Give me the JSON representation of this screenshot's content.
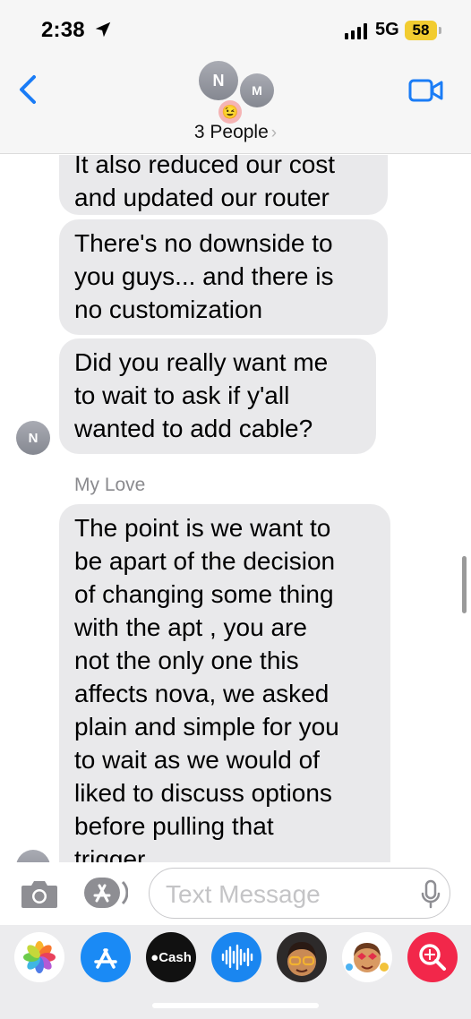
{
  "status_bar": {
    "time": "2:38",
    "network": "5G",
    "battery": "58",
    "battery_color": "#f2cc30"
  },
  "header": {
    "avatars": [
      "N",
      "M"
    ],
    "emoji_avatar": "😉",
    "title": "3 People",
    "chevron": "›",
    "back_icon": "chevron-left-icon",
    "video_icon": "video-camera-icon",
    "accent_color": "#1a7cf6"
  },
  "messages": [
    {
      "lines": [
        "It also reduced our cost",
        "and updated our router"
      ]
    },
    {
      "lines": [
        "There's no downside to",
        "you guys... and there is",
        "no customization"
      ]
    },
    {
      "lines": [
        "Did you really want me",
        "to wait to ask if y'all",
        "wanted to add cable?"
      ],
      "avatar": "N"
    },
    {
      "sender": "My Love",
      "lines": [
        "The point is we want to",
        "be apart of the decision",
        "of changing some thing",
        "with the apt , you are",
        "not the only one this",
        "affects nova, we asked",
        "plain and simple for you",
        "to wait as we would of",
        "liked to discuss options",
        "before pulling that",
        "trigger"
      ]
    }
  ],
  "input_bar": {
    "placeholder": "Text Message",
    "camera_icon": "camera-icon",
    "apps_icon": "app-store-icon",
    "mic_icon": "microphone-icon"
  },
  "app_drawer": {
    "apps": [
      {
        "name": "photos-app-icon"
      },
      {
        "name": "app-store-app-icon"
      },
      {
        "name": "apple-cash-app-icon",
        "label": "Cash"
      },
      {
        "name": "audio-message-app-icon"
      },
      {
        "name": "memoji-app-icon"
      },
      {
        "name": "memoji-stickers-app-icon"
      },
      {
        "name": "image-search-app-icon"
      }
    ]
  }
}
